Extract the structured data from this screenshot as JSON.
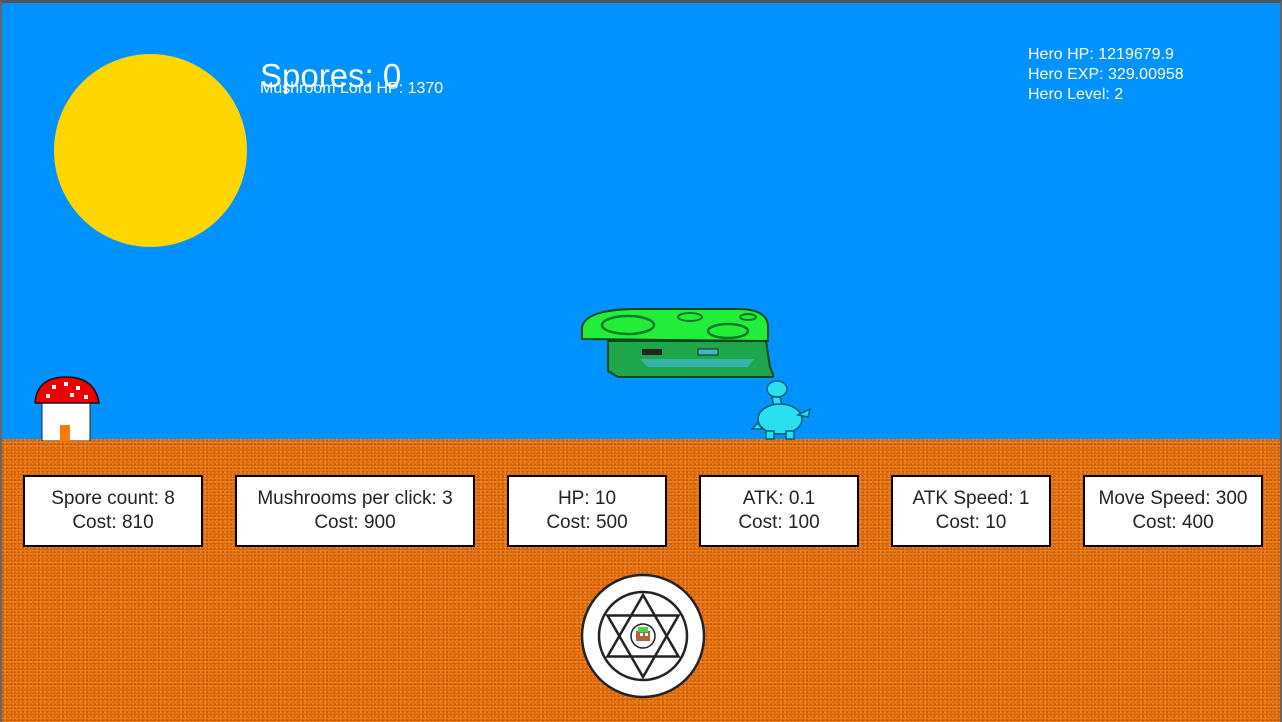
{
  "hud": {
    "spores": "Spores: 0",
    "mushroom_lord_hp": "Mushroom Lord HP: 1370",
    "hero_hp": "Hero HP: 1219679.9",
    "hero_exp": "Hero EXP: 329.00958",
    "hero_level": "Hero Level: 2"
  },
  "upgrades": [
    {
      "label": "Spore count: 8",
      "cost": "Cost: 810"
    },
    {
      "label": "Mushrooms per click: 3",
      "cost": "Cost: 900"
    },
    {
      "label": "HP: 10",
      "cost": "Cost: 500"
    },
    {
      "label": "ATK: 0.1",
      "cost": "Cost: 100"
    },
    {
      "label": "ATK Speed: 1",
      "cost": "Cost: 10"
    },
    {
      "label": "Move Speed: 300",
      "cost": "Cost: 400"
    }
  ],
  "colors": {
    "sky": "#0092ff",
    "ground": "#f07a14",
    "sun": "#ffd600",
    "boss_cap": "#22ee3a",
    "boss_body": "#1ea64a",
    "hero": "#29e0f0"
  },
  "icons": [
    "sun-icon",
    "mushroom-house-icon",
    "mushroom-lord-boss",
    "hero-creature",
    "hexagram-portal-button"
  ]
}
